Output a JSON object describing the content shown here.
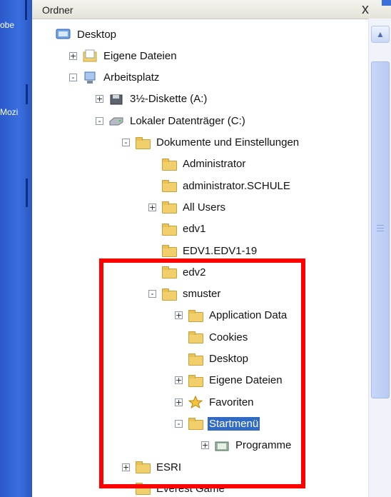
{
  "strip": {
    "texts": [
      "obe",
      "Mozi"
    ]
  },
  "header": {
    "title": "Ordner",
    "close": "x"
  },
  "tree": [
    {
      "label": "Desktop",
      "icon": "desktop-icon",
      "expander": "none",
      "indent": 0
    },
    {
      "label": "Eigene Dateien",
      "icon": "my-documents-icon",
      "expander": "+",
      "indent": 1
    },
    {
      "label": "Arbeitsplatz",
      "icon": "my-computer-icon",
      "expander": "-",
      "indent": 1
    },
    {
      "label": "3½-Diskette (A:)",
      "icon": "floppy-drive-icon",
      "expander": "+",
      "indent": 2
    },
    {
      "label": "Lokaler Datenträger (C:)",
      "icon": "hard-drive-icon",
      "expander": "-",
      "indent": 2
    },
    {
      "label": "Dokumente und Einstellungen",
      "icon": "folder-icon",
      "expander": "-",
      "indent": 3
    },
    {
      "label": "Administrator",
      "icon": "folder-icon",
      "expander": "none",
      "indent": 4
    },
    {
      "label": "administrator.SCHULE",
      "icon": "folder-icon",
      "expander": "none",
      "indent": 4
    },
    {
      "label": "All Users",
      "icon": "folder-icon",
      "expander": "+",
      "indent": 4
    },
    {
      "label": "edv1",
      "icon": "folder-icon",
      "expander": "none",
      "indent": 4
    },
    {
      "label": "EDV1.EDV1-19",
      "icon": "folder-icon",
      "expander": "none",
      "indent": 4
    },
    {
      "label": "edv2",
      "icon": "folder-icon",
      "expander": "none",
      "indent": 4
    },
    {
      "label": "smuster",
      "icon": "folder-icon",
      "expander": "-",
      "indent": 4
    },
    {
      "label": "Application Data",
      "icon": "folder-icon",
      "expander": "+",
      "indent": 5
    },
    {
      "label": "Cookies",
      "icon": "folder-icon",
      "expander": "none",
      "indent": 5
    },
    {
      "label": "Desktop",
      "icon": "folder-icon",
      "expander": "none",
      "indent": 5
    },
    {
      "label": "Eigene Dateien",
      "icon": "folder-icon",
      "expander": "+",
      "indent": 5
    },
    {
      "label": "Favoriten",
      "icon": "favorites-star-icon",
      "expander": "+",
      "indent": 5
    },
    {
      "label": "Startmenü",
      "icon": "folder-icon",
      "expander": "-",
      "indent": 5,
      "selected": true
    },
    {
      "label": "Programme",
      "icon": "programs-folder-icon",
      "expander": "+",
      "indent": 6
    },
    {
      "label": "ESRI",
      "icon": "folder-icon",
      "expander": "+",
      "indent": 3
    },
    {
      "label": "Everest Game",
      "icon": "folder-icon",
      "expander": "none",
      "indent": 3
    }
  ],
  "colors": {
    "selection": "#316ac5",
    "highlight_box": "#ff0000",
    "folder": "#f1cf6b"
  }
}
